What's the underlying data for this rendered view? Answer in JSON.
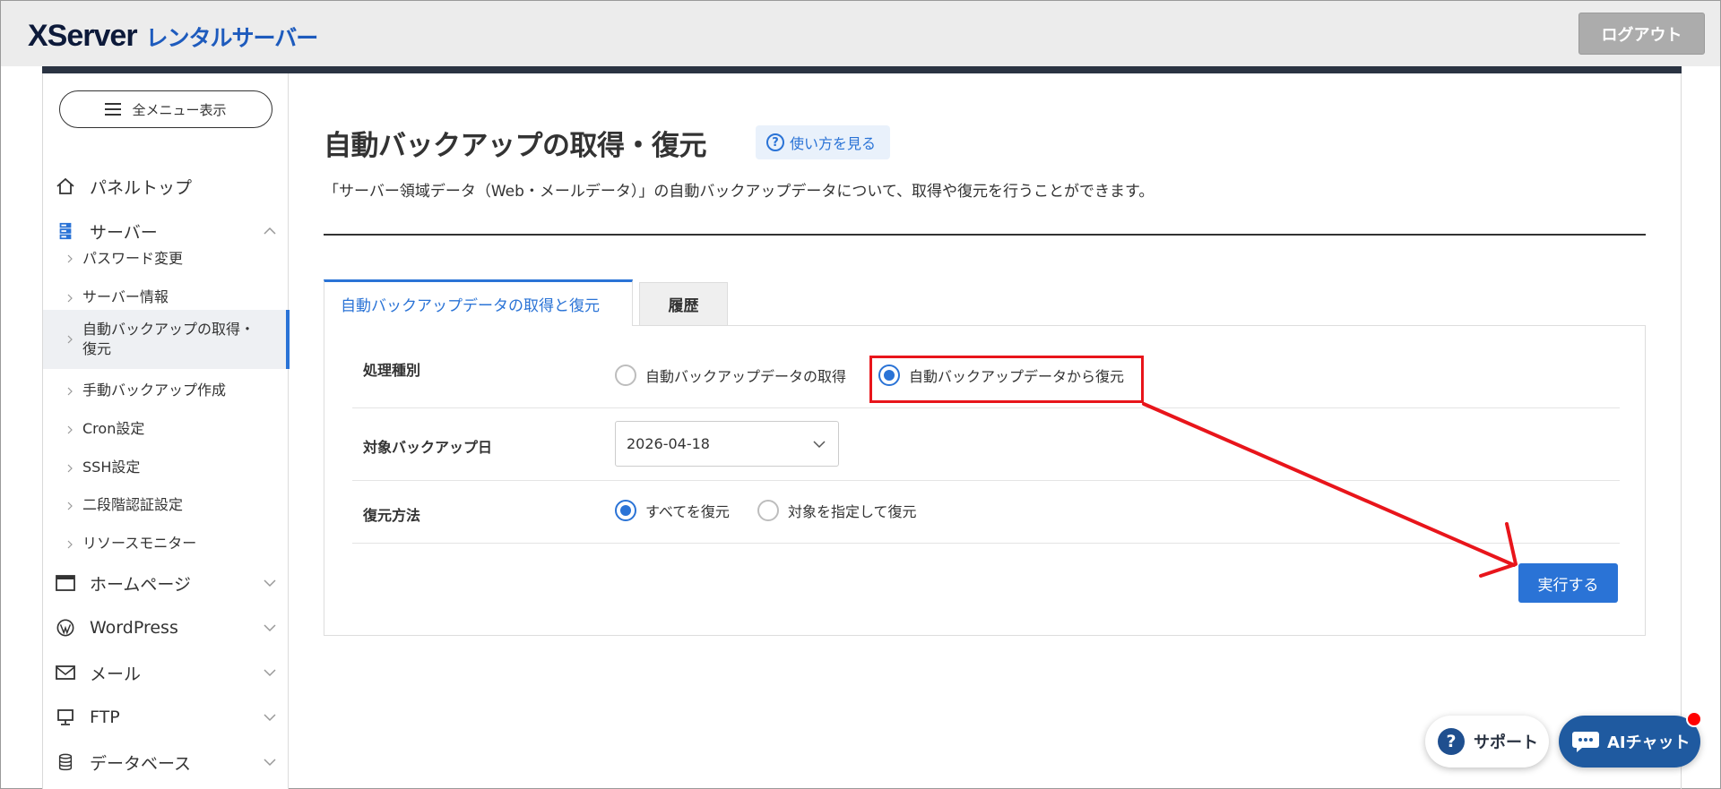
{
  "header": {
    "logo_brand": "XServer",
    "logo_sub": "レンタルサーバー",
    "logout_label": "ログアウト"
  },
  "sidebar": {
    "menu_button_label": "全メニュー表示",
    "panel_top": "パネルトップ",
    "server": "サーバー",
    "server_items": [
      "パスワード変更",
      "サーバー情報",
      "自動バックアップの取得・",
      "復元",
      "手動バックアップ作成",
      "Cron設定",
      "SSH設定",
      "二段階認証設定",
      "リソースモニター"
    ],
    "homepage": "ホームページ",
    "wordpress": "WordPress",
    "mail": "メール",
    "ftp": "FTP",
    "database": "データベース"
  },
  "main": {
    "title": "自動バックアップの取得・復元",
    "howto_label": "使い方を見る",
    "description": "「サーバー領域データ（Web・メールデータ）」の自動バックアップデータについて、取得や復元を行うことができます。",
    "tabs": [
      {
        "label": "自動バックアップデータの取得と復元",
        "active": true
      },
      {
        "label": "履歴",
        "active": false
      }
    ],
    "form": {
      "process_type_label": "処理種別",
      "process_options": [
        {
          "label": "自動バックアップデータの取得",
          "checked": false
        },
        {
          "label": "自動バックアップデータから復元",
          "checked": true
        }
      ],
      "target_date_label": "対象バックアップ日",
      "target_date_value": "2026-04-18",
      "restore_method_label": "復元方法",
      "restore_options": [
        {
          "label": "すべてを復元",
          "checked": true
        },
        {
          "label": "対象を指定して復元",
          "checked": false
        }
      ],
      "execute_label": "実行する"
    }
  },
  "floating": {
    "support_label": "サポート",
    "ai_chat_label": "AIチャット"
  },
  "colors": {
    "accent": "#2a73d6",
    "annotation": "#e8151b",
    "header_bg": "#ececec",
    "dark_bar": "#2a3342"
  }
}
